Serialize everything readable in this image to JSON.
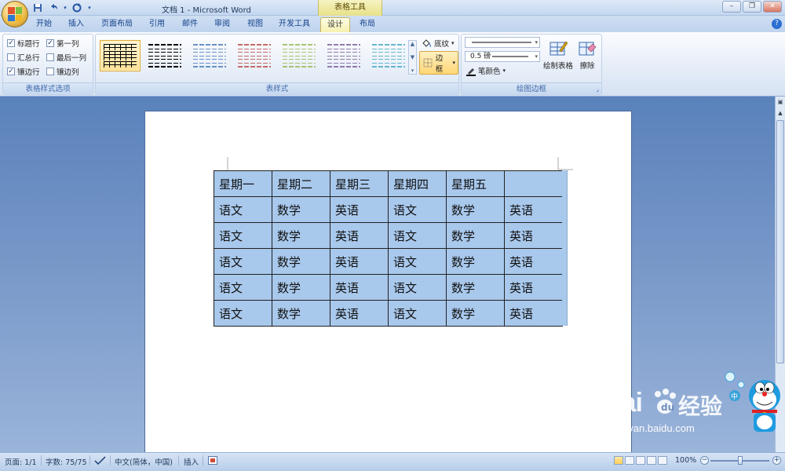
{
  "window": {
    "title": "文档 1 - Microsoft Word",
    "context_tool": "表格工具",
    "controls": [
      "–",
      "❐",
      "✕"
    ]
  },
  "tabs": [
    {
      "label": "开始",
      "active": false
    },
    {
      "label": "插入",
      "active": false
    },
    {
      "label": "页面布局",
      "active": false
    },
    {
      "label": "引用",
      "active": false
    },
    {
      "label": "邮件",
      "active": false
    },
    {
      "label": "审阅",
      "active": false
    },
    {
      "label": "视图",
      "active": false
    },
    {
      "label": "开发工具",
      "active": false
    },
    {
      "label": "设计",
      "active": true
    },
    {
      "label": "布局",
      "active": false
    }
  ],
  "ribbon": {
    "style_options": {
      "label": "表格样式选项",
      "items": [
        {
          "label": "标题行",
          "checked": true
        },
        {
          "label": "第一列",
          "checked": true
        },
        {
          "label": "汇总行",
          "checked": false
        },
        {
          "label": "最后一列",
          "checked": false
        },
        {
          "label": "镶边行",
          "checked": true
        },
        {
          "label": "镶边列",
          "checked": false
        }
      ]
    },
    "table_styles": {
      "label": "表样式",
      "shading_label": "底纹",
      "borders_label": "边框",
      "style_colors": [
        "#000000",
        "#000000",
        "#4f81bd",
        "#c0504d",
        "#9bbb59",
        "#8064a2",
        "#4bacc6"
      ]
    },
    "draw_borders": {
      "label": "绘图边框",
      "weight": "0.5 磅",
      "pen_color_label": "笔颜色",
      "draw_table_label": "绘制表格",
      "eraser_label": "擦除"
    }
  },
  "table": {
    "header": [
      "星期一",
      "星期二",
      "星期三",
      "星期四",
      "星期五",
      ""
    ],
    "rows": [
      [
        "语文",
        "数学",
        "英语",
        "语文",
        "数学",
        "英语"
      ],
      [
        "语文",
        "数学",
        "英语",
        "语文",
        "数学",
        "英语"
      ],
      [
        "语文",
        "数学",
        "英语",
        "语文",
        "数学",
        "英语"
      ],
      [
        "语文",
        "数学",
        "英语",
        "语文",
        "数学",
        "英语"
      ],
      [
        "语文",
        "数学",
        "英语",
        "语文",
        "数学",
        "英语"
      ]
    ],
    "cell_color": "#a8c8ec"
  },
  "status": {
    "page": "页面: 1/1",
    "words": "字数: 75/75",
    "language": "中文(简体，中国)",
    "mode": "插入",
    "zoom": "100%"
  },
  "watermark": {
    "brand": "Bai",
    "brand_cn": "经验",
    "url": "jingyan.baidu.com"
  }
}
